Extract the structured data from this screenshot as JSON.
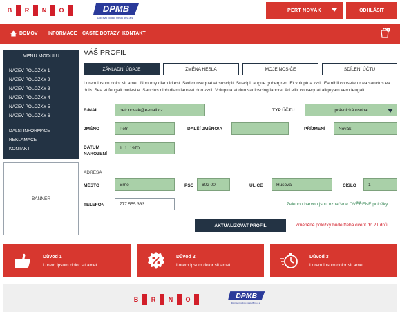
{
  "header": {
    "brno_letters": [
      "B",
      "R",
      "N",
      "O"
    ],
    "dpmb_logo_text": "DPMB",
    "dpmb_logo_subtext": "Dopravní podnik města Brna a.s.",
    "user_name": "PERT NOVÁK",
    "logout_label": "ODHLÁSIT"
  },
  "nav": {
    "items": [
      "DOMOV",
      "INFORMACE",
      "ČASTÉ DOTAZY",
      "KONTAKT"
    ],
    "cart_count": "0",
    "accent_color": "#d7372f"
  },
  "sidebar": {
    "title": "MENU MODULU",
    "items": [
      "NAZEV POLOZKY 1",
      "NAZEV POLOZKY 2",
      "NAZEV POLOZKY 3",
      "NAZEV POLOZKY 4",
      "NAZEV POLOZKY 5",
      "NAZEV POLOZKY 6"
    ],
    "extra_items": [
      "DALSI INFORMACE",
      "REKLAMACE",
      "KONTAKT"
    ],
    "banner": "BANNER"
  },
  "main": {
    "title": "VÁŠ PROFIL",
    "tabs": [
      "ZÁKLADNÍ ÚDAJE",
      "ZMĚNA HESLA",
      "MOJE NOSIČE",
      "SDÍLENÍ ÚČTU"
    ],
    "intro": "Lorem ipsum dolor sit amet. Nonumy diam id est. Sed consequat et suscipit. Suscipit augue gubergren. Et voluptua zzril. Ea nihil consetetur ea sanctus ea duis. Sea et feugait molestie. Sanctus nibh diam laoreet duo zzril. Voluptua et duo sadipscing labore. Ad elitr consequat aliquyam vero feugait.",
    "form": {
      "email_label": "E-MAIL",
      "email_value": "petr.novak@e-mail.cz",
      "account_type_label": "TYP ÚČTU",
      "account_type_value": "právnická osoba",
      "first_name_label": "JMÉNO",
      "first_name_value": "Petr",
      "middle_name_label": "DALŠÍ JMÉNO/A",
      "middle_name_value": "",
      "last_name_label": "PŘÍJMENÍ",
      "last_name_value": "Novák",
      "dob_label_1": "DATUM",
      "dob_label_2": "NAROZENÍ",
      "dob_value": "1. 1. 1970",
      "address_heading": "ADRESA",
      "city_label": "MĚSTO",
      "city_value": "Brno",
      "zip_label": "PSČ",
      "zip_value": "602 00",
      "street_label": "ULICE",
      "street_value": "Husova",
      "number_label": "ČÍSLO",
      "number_value": "1",
      "phone_label": "TELEFON",
      "phone_value": "777 555 333",
      "verified_hint": "Zelenou barvou jsou označené OVĚŘENÉ položky.",
      "submit_label": "AKTUALIZOVAT PROFIL",
      "change_hint": "Změněné položky bude třeba ověřit do 21 dnů."
    }
  },
  "reasons": [
    {
      "title": "Důvod 1",
      "text": "Lorem ipsum dolor sit amet",
      "icon": "thumbs-up-icon"
    },
    {
      "title": "Důvod 2",
      "text": "Lorem ipsum dolor sit amet",
      "icon": "percent-icon"
    },
    {
      "title": "Důvod 3",
      "text": "Lorem ipsum dolor sit amet",
      "icon": "fast-clock-icon"
    }
  ]
}
